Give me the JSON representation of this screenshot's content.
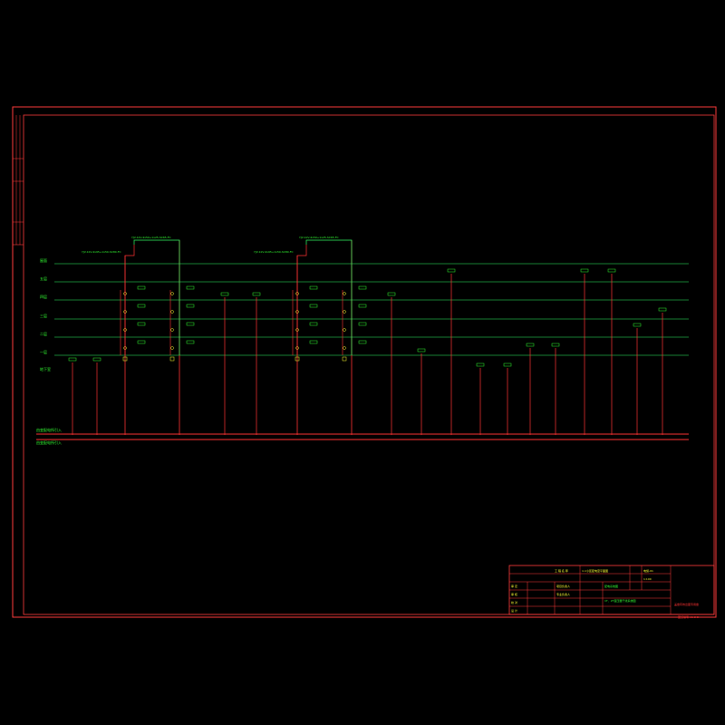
{
  "colors": {
    "background": "#000000",
    "frame": "#ff3b3b",
    "bus_line": "#33ff66",
    "riser": "#ff3333",
    "text_green": "#33ff33",
    "text_yellow": "#ffff33",
    "mains": "#ff3333"
  },
  "floors": [
    {
      "label": "屋面"
    },
    {
      "label": "五层"
    },
    {
      "label": "四层"
    },
    {
      "label": "三层"
    },
    {
      "label": "二层"
    },
    {
      "label": "一层"
    },
    {
      "label": "地下室"
    }
  ],
  "mains_labels": {
    "line1": "由变配电所引入",
    "line2": "由变配电所引入"
  },
  "feeders": [
    {
      "label": "YJV-1kV-4x95+1x50-SC80-FC",
      "panel_label": "AL1-1"
    },
    {
      "label": "YJV-1kV-4x50+1x25-SC65-FC",
      "panel_label": "AL1-2"
    }
  ],
  "title_block": {
    "company": "工 程 名 称",
    "project": "××小区配电室平面图",
    "drawing_title": "配电系统图",
    "sheet_title": "1T、2T变压器干线系统图",
    "drawing_no": "电施-01",
    "scale": "1:100",
    "rows": [
      "审 定",
      "审 核",
      "校 对",
      "设 计",
      "项目负责人",
      "专业负责人"
    ],
    "stamp": "盖章有效出图专用章"
  },
  "bottom_note": "图纸编号 A1-2-E"
}
